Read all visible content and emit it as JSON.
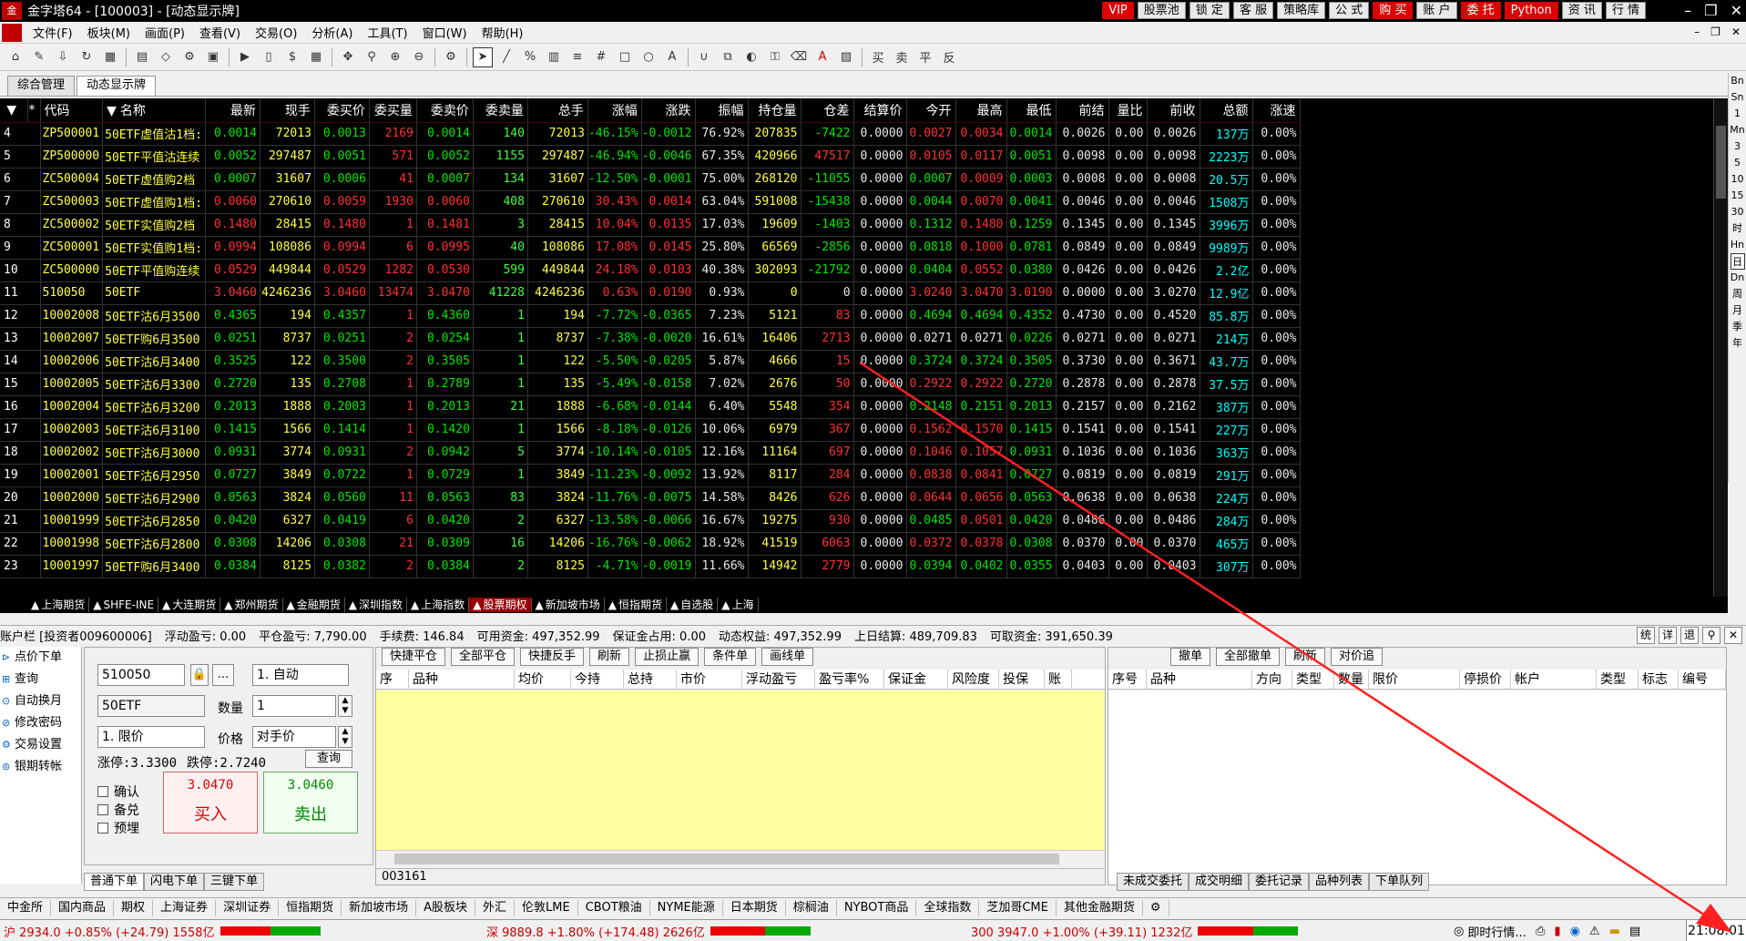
{
  "window": {
    "title": "金字塔64 - [100003] - [动态显示牌]",
    "logo_text": "金"
  },
  "topbuttons": [
    {
      "label": "VIP",
      "red": true
    },
    {
      "label": "股票池",
      "red": false
    },
    {
      "label": "锁 定",
      "red": false
    },
    {
      "label": "客 服",
      "red": false
    },
    {
      "label": "策略库",
      "red": false
    },
    {
      "label": "公 式",
      "red": false
    },
    {
      "label": "购 买",
      "red": true
    },
    {
      "label": "账 户",
      "red": false
    },
    {
      "label": "委 托",
      "red": true
    },
    {
      "label": "Python",
      "red": true
    },
    {
      "label": "资 讯",
      "red": false
    },
    {
      "label": "行 情",
      "red": false
    }
  ],
  "menu": [
    "文件(F)",
    "板块(M)",
    "画面(P)",
    "查看(V)",
    "交易(O)",
    "分析(A)",
    "工具(T)",
    "窗口(W)",
    "帮助(H)"
  ],
  "page_tabs": [
    "综合管理",
    "动态显示牌"
  ],
  "rightbar": [
    "Bn",
    "Sn",
    "1",
    "Mn",
    "3",
    "5",
    "10",
    "15",
    "30",
    "时",
    "Hn",
    "日",
    "Dn",
    "周",
    "月",
    "季",
    "年"
  ],
  "columns": [
    "代码",
    "名称",
    "最新",
    "现手",
    "委买价",
    "委买量",
    "委卖价",
    "委卖量",
    "总手",
    "涨幅",
    "涨跌",
    "振幅",
    "持仓量",
    "仓差",
    "结算价",
    "今开",
    "最高",
    "最低",
    "前结",
    "量比",
    "前收",
    "总额",
    "涨速"
  ],
  "rows": [
    {
      "n": "4",
      "code": "ZP500001",
      "name": "50ETF虚值沽1档:",
      "v": [
        "0.0014",
        "72013",
        "0.0013",
        "2169",
        "0.0014",
        "140",
        "72013",
        "-46.15%",
        "-0.0012",
        "76.92%",
        "207835",
        "-7422",
        "0.0000",
        "0.0027",
        "0.0034",
        "0.0014",
        "0.0026",
        "0.00",
        "0.0026",
        "137万",
        "0.00%"
      ]
    },
    {
      "n": "5",
      "code": "ZP500000",
      "name": "50ETF平值沽连续",
      "v": [
        "0.0052",
        "297487",
        "0.0051",
        "571",
        "0.0052",
        "1155",
        "297487",
        "-46.94%",
        "-0.0046",
        "67.35%",
        "420966",
        "47517",
        "0.0000",
        "0.0105",
        "0.0117",
        "0.0051",
        "0.0098",
        "0.00",
        "0.0098",
        "2223万",
        "0.00%"
      ]
    },
    {
      "n": "6",
      "code": "ZC500004",
      "name": "50ETF虚值购2档",
      "v": [
        "0.0007",
        "31607",
        "0.0006",
        "41",
        "0.0007",
        "134",
        "31607",
        "-12.50%",
        "-0.0001",
        "75.00%",
        "268120",
        "-11055",
        "0.0000",
        "0.0007",
        "0.0009",
        "0.0003",
        "0.0008",
        "0.00",
        "0.0008",
        "20.5万",
        "0.00%"
      ]
    },
    {
      "n": "7",
      "code": "ZC500003",
      "name": "50ETF虚值购1档:",
      "v": [
        "0.0060",
        "270610",
        "0.0059",
        "1930",
        "0.0060",
        "408",
        "270610",
        "30.43%",
        "0.0014",
        "63.04%",
        "591008",
        "-15438",
        "0.0000",
        "0.0044",
        "0.0070",
        "0.0041",
        "0.0046",
        "0.00",
        "0.0046",
        "1508万",
        "0.00%"
      ]
    },
    {
      "n": "8",
      "code": "ZC500002",
      "name": "50ETF实值购2档",
      "v": [
        "0.1480",
        "28415",
        "0.1480",
        "1",
        "0.1481",
        "3",
        "28415",
        "10.04%",
        "0.0135",
        "17.03%",
        "19609",
        "-1403",
        "0.0000",
        "0.1312",
        "0.1480",
        "0.1259",
        "0.1345",
        "0.00",
        "0.1345",
        "3996万",
        "0.00%"
      ]
    },
    {
      "n": "9",
      "code": "ZC500001",
      "name": "50ETF实值购1档:",
      "v": [
        "0.0994",
        "108086",
        "0.0994",
        "6",
        "0.0995",
        "40",
        "108086",
        "17.08%",
        "0.0145",
        "25.80%",
        "66569",
        "-2856",
        "0.0000",
        "0.0818",
        "0.1000",
        "0.0781",
        "0.0849",
        "0.00",
        "0.0849",
        "9989万",
        "0.00%"
      ]
    },
    {
      "n": "10",
      "code": "ZC500000",
      "name": "50ETF平值购连续",
      "v": [
        "0.0529",
        "449844",
        "0.0529",
        "1282",
        "0.0530",
        "599",
        "449844",
        "24.18%",
        "0.0103",
        "40.38%",
        "302093",
        "-21792",
        "0.0000",
        "0.0404",
        "0.0552",
        "0.0380",
        "0.0426",
        "0.00",
        "0.0426",
        "2.2亿",
        "0.00%"
      ]
    },
    {
      "n": "11",
      "code": "510050",
      "name": "50ETF",
      "v": [
        "3.0460",
        "4246236",
        "3.0460",
        "13474",
        "3.0470",
        "41228",
        "4246236",
        "0.63%",
        "0.0190",
        "0.93%",
        "0",
        "0",
        "0.0000",
        "3.0240",
        "3.0470",
        "3.0190",
        "0.0000",
        "0.00",
        "3.0270",
        "12.9亿",
        "0.00%"
      ]
    },
    {
      "n": "12",
      "code": "10002008",
      "name": "50ETF沽6月3500",
      "v": [
        "0.4365",
        "194",
        "0.4357",
        "1",
        "0.4360",
        "1",
        "194",
        "-7.72%",
        "-0.0365",
        "7.23%",
        "5121",
        "83",
        "0.0000",
        "0.4694",
        "0.4694",
        "0.4352",
        "0.4730",
        "0.00",
        "0.4520",
        "85.8万",
        "0.00%"
      ]
    },
    {
      "n": "13",
      "code": "10002007",
      "name": "50ETF购6月3500",
      "v": [
        "0.0251",
        "8737",
        "0.0251",
        "2",
        "0.0254",
        "1",
        "8737",
        "-7.38%",
        "-0.0020",
        "16.61%",
        "16406",
        "2713",
        "0.0000",
        "0.0271",
        "0.0271",
        "0.0226",
        "0.0271",
        "0.00",
        "0.0271",
        "214万",
        "0.00%"
      ]
    },
    {
      "n": "14",
      "code": "10002006",
      "name": "50ETF沽6月3400",
      "v": [
        "0.3525",
        "122",
        "0.3500",
        "2",
        "0.3505",
        "1",
        "122",
        "-5.50%",
        "-0.0205",
        "5.87%",
        "4666",
        "15",
        "0.0000",
        "0.3724",
        "0.3724",
        "0.3505",
        "0.3730",
        "0.00",
        "0.3671",
        "43.7万",
        "0.00%"
      ]
    },
    {
      "n": "15",
      "code": "10002005",
      "name": "50ETF沽6月3300",
      "v": [
        "0.2720",
        "135",
        "0.2708",
        "1",
        "0.2789",
        "1",
        "135",
        "-5.49%",
        "-0.0158",
        "7.02%",
        "2676",
        "50",
        "0.0000",
        "0.2922",
        "0.2922",
        "0.2720",
        "0.2878",
        "0.00",
        "0.2878",
        "37.5万",
        "0.00%"
      ]
    },
    {
      "n": "16",
      "code": "10002004",
      "name": "50ETF沽6月3200",
      "v": [
        "0.2013",
        "1888",
        "0.2003",
        "1",
        "0.2013",
        "21",
        "1888",
        "-6.68%",
        "-0.0144",
        "6.40%",
        "5548",
        "354",
        "0.0000",
        "0.2148",
        "0.2151",
        "0.2013",
        "0.2157",
        "0.00",
        "0.2162",
        "387万",
        "0.00%"
      ]
    },
    {
      "n": "17",
      "code": "10002003",
      "name": "50ETF沽6月3100",
      "v": [
        "0.1415",
        "1566",
        "0.1414",
        "1",
        "0.1420",
        "1",
        "1566",
        "-8.18%",
        "-0.0126",
        "10.06%",
        "6979",
        "367",
        "0.0000",
        "0.1562",
        "0.1570",
        "0.1415",
        "0.1541",
        "0.00",
        "0.1541",
        "227万",
        "0.00%"
      ]
    },
    {
      "n": "18",
      "code": "10002002",
      "name": "50ETF沽6月3000",
      "v": [
        "0.0931",
        "3774",
        "0.0931",
        "2",
        "0.0942",
        "5",
        "3774",
        "-10.14%",
        "-0.0105",
        "12.16%",
        "11164",
        "697",
        "0.0000",
        "0.1046",
        "0.1057",
        "0.0931",
        "0.1036",
        "0.00",
        "0.1036",
        "363万",
        "0.00%"
      ]
    },
    {
      "n": "19",
      "code": "10002001",
      "name": "50ETF沽6月2950",
      "v": [
        "0.0727",
        "3849",
        "0.0722",
        "1",
        "0.0729",
        "1",
        "3849",
        "-11.23%",
        "-0.0092",
        "13.92%",
        "8117",
        "284",
        "0.0000",
        "0.0838",
        "0.0841",
        "0.0727",
        "0.0819",
        "0.00",
        "0.0819",
        "291万",
        "0.00%"
      ]
    },
    {
      "n": "20",
      "code": "10002000",
      "name": "50ETF沽6月2900",
      "v": [
        "0.0563",
        "3824",
        "0.0560",
        "11",
        "0.0563",
        "83",
        "3824",
        "-11.76%",
        "-0.0075",
        "14.58%",
        "8426",
        "626",
        "0.0000",
        "0.0644",
        "0.0656",
        "0.0563",
        "0.0638",
        "0.00",
        "0.0638",
        "224万",
        "0.00%"
      ]
    },
    {
      "n": "21",
      "code": "10001999",
      "name": "50ETF沽6月2850",
      "v": [
        "0.0420",
        "6327",
        "0.0419",
        "6",
        "0.0420",
        "2",
        "6327",
        "-13.58%",
        "-0.0066",
        "16.67%",
        "19275",
        "930",
        "0.0000",
        "0.0485",
        "0.0501",
        "0.0420",
        "0.0486",
        "0.00",
        "0.0486",
        "284万",
        "0.00%"
      ]
    },
    {
      "n": "22",
      "code": "10001998",
      "name": "50ETF沽6月2800",
      "v": [
        "0.0308",
        "14206",
        "0.0308",
        "21",
        "0.0309",
        "16",
        "14206",
        "-16.76%",
        "-0.0062",
        "18.92%",
        "41519",
        "6063",
        "0.0000",
        "0.0372",
        "0.0378",
        "0.0308",
        "0.0370",
        "0.00",
        "0.0370",
        "465万",
        "0.00%"
      ]
    },
    {
      "n": "23",
      "code": "10001997",
      "name": "50ETF购6月3400",
      "v": [
        "0.0384",
        "8125",
        "0.0382",
        "2",
        "0.0384",
        "2",
        "8125",
        "-4.71%",
        "-0.0019",
        "11.66%",
        "14942",
        "2779",
        "0.0000",
        "0.0394",
        "0.0402",
        "0.0355",
        "0.0403",
        "0.00",
        "0.0403",
        "307万",
        "0.00%"
      ]
    }
  ],
  "market_tabs": [
    "上海期货",
    "SHFE-INE",
    "大连期货",
    "郑州期货",
    "金融期货",
    "深圳指数",
    "上海指数",
    "股票期权",
    "新加坡市场",
    "恒指期货",
    "自选股",
    "上海"
  ],
  "market_active": "股票期权",
  "account": {
    "label": "账户栏 [投资者009600006]",
    "float_pl": "浮动盈亏: 0.00",
    "close_pl": "平仓盈亏: 7,790.00",
    "fee": "手续费: 146.84",
    "avail": "可用资金: 497,352.99",
    "margin": "保证金占用: 0.00",
    "equity": "动态权益: 497,352.99",
    "last_settle": "上日结算: 489,709.83",
    "withdraw": "可取资金: 391,650.39",
    "rbtns": [
      "统",
      "详",
      "退"
    ]
  },
  "leftnav": [
    "点价下单",
    "查询",
    "自动换月",
    "修改密码",
    "交易设置",
    "银期转帐"
  ],
  "order": {
    "code": "510050",
    "auto": "1. 自动",
    "name": "50ETF",
    "qty_label": "数量",
    "qty": "1",
    "ptype": "1. 限价",
    "price_label": "价格",
    "price": "对手价",
    "limit_up": "涨停:3.3300",
    "limit_down": "跌停:2.7240",
    "query": "查询",
    "buy_price": "3.0470",
    "buy_label": "买入",
    "sell_price": "3.0460",
    "sell_label": "卖出",
    "chk": [
      "确认",
      "备兑",
      "预埋"
    ],
    "ellipsis": "..."
  },
  "order_tabs": [
    "普通下单",
    "闪电下单",
    "三键下单"
  ],
  "pos_buttons": [
    "快捷平仓",
    "全部平仓",
    "快捷反手",
    "刷新",
    "止损止赢",
    "条件单",
    "画线单"
  ],
  "pos_cols": [
    "序",
    "品种",
    "均价",
    "今持",
    "总持",
    "市价",
    "浮动盈亏",
    "盈亏率%",
    "保证金",
    "风险度",
    "投保",
    "账"
  ],
  "pos_status": "003161",
  "ord_buttons": [
    "撤单",
    "全部撤单",
    "刷新",
    "对价追"
  ],
  "ord_cols": [
    "序号",
    "品种",
    "方向",
    "类型",
    "数量",
    "限价",
    "停损价",
    "帐户",
    "类型",
    "标志",
    "编号"
  ],
  "ord_tabs": [
    "未成交委托",
    "成交明细",
    "委托记录",
    "品种列表",
    "下单队列"
  ],
  "exchanges": [
    "中金所",
    "国内商品",
    "期权",
    "上海证券",
    "深圳证券",
    "恒指期货",
    "新加坡市场",
    "A股板块",
    "外汇",
    "伦敦LME",
    "CBOT粮油",
    "NYME能源",
    "日本期货",
    "棕榈油",
    "NYBOT商品",
    "全球指数",
    "芝加哥CME",
    "其他金融期货"
  ],
  "status": {
    "sh": "沪 2934.0 +0.85% (+24.79) 1558亿",
    "sh_up": 0.5,
    "sz": "深 9889.8 +1.80% (+174.48) 2626亿",
    "sz_up": 0.55,
    "i300": "300 3947.0 +1.00% (+39.11) 1232亿",
    "i300_up": 0.55,
    "realtime": "即时行情...",
    "clock": "21:08:01"
  },
  "colors": {
    "up": "#ff3030",
    "down": "#00e600",
    "flat": "#e8e8e8",
    "yellow": "#ffff40",
    "cyan": "#00ffff",
    "annotation": "#ff2020"
  }
}
